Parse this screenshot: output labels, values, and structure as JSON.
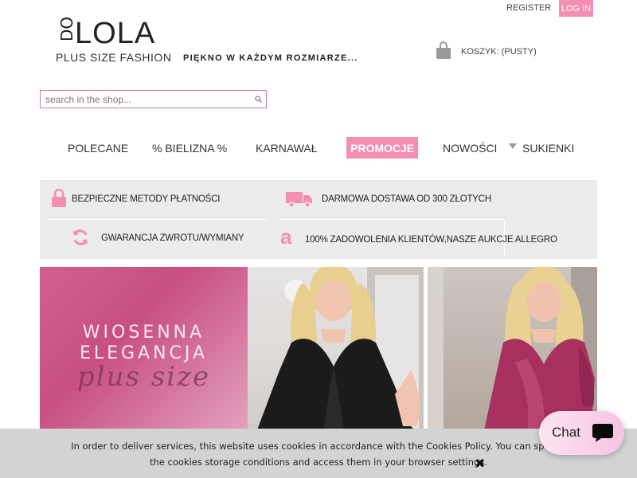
{
  "header": {
    "register_label": "REGISTER",
    "login_label": "LOG IN",
    "logo_prefix": "DO",
    "logo_name": "LOLA",
    "logo_sub": "PLUS SIZE FASHION",
    "tagline": "PIĘKNO W KAŻDYM ROZMIARZE...",
    "cart_label": "KOSZYK: (PUSTY)"
  },
  "search": {
    "placeholder": "search in the shop..."
  },
  "nav": {
    "items": [
      {
        "label": "POLECANE"
      },
      {
        "label": "% BIELIZNA %"
      },
      {
        "label": "KARNAWAŁ"
      },
      {
        "label": "PROMOCJE",
        "highlight": true
      },
      {
        "label": "NOWOŚCI"
      },
      {
        "label": "SUKIENKI",
        "has_dropdown": true
      }
    ]
  },
  "features": {
    "items": [
      {
        "icon": "lock-icon",
        "label": "BEZPIECZNE METODY PŁATNOŚCI"
      },
      {
        "icon": "truck-icon",
        "label": "DARMOWA DOSTAWA OD 300 ZŁOTYCH"
      },
      {
        "icon": "refresh-icon",
        "label": "GWARANCJA ZWROTU/WYMIANY"
      },
      {
        "icon": "allegro-icon",
        "label": "100% ZADOWOLENIA KLIENTÓW,NASZE AUKCJE ALLEGRO"
      }
    ]
  },
  "banner": {
    "line1": "WIOSENNA",
    "line2": "ELEGANCJA",
    "script": "plus size"
  },
  "cookie": {
    "line1": "In order to deliver services, this website uses cookies in accordance with the Cookies Policy. You can specify",
    "line2": "the cookies storage conditions and access them in your browser settings."
  },
  "chat": {
    "label": "Chat"
  },
  "colors": {
    "accent": "#f48fb1",
    "banner_pink": "#c74f82",
    "cookie_bg": "#d3d3d3"
  }
}
